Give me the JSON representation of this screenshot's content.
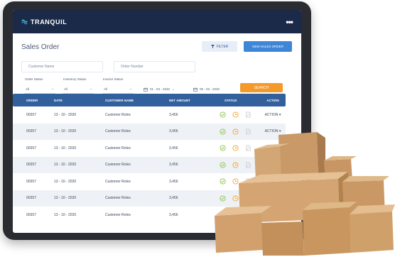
{
  "app": {
    "brand": "TRANQUIL",
    "menu": "•••"
  },
  "page": {
    "title": "Sales Order"
  },
  "toolbar": {
    "filter_label": "FILTER",
    "new_label": "NEW SALES ORDER"
  },
  "fields": {
    "customer_name_placeholder": "Customer Name",
    "order_number_placeholder": "Order Number"
  },
  "selects": [
    {
      "label": "Order Status",
      "value": "All"
    },
    {
      "label": "Inventory Status",
      "value": "All"
    },
    {
      "label": "Invoice Status",
      "value": "All"
    }
  ],
  "dates": {
    "from": "01 - 03 - 2020",
    "to": "05 - 03 - 2020"
  },
  "search_label": "SEARCH",
  "table": {
    "headers": [
      "ORDER",
      "DATE",
      "CUSTOMER NAME",
      "NET AMOUNT",
      "STATUS",
      "ACTION"
    ],
    "rows": [
      {
        "order": "00357",
        "date": "13 - 10 - 2020",
        "customer": "Customer Roles",
        "amount": "3,456",
        "action": "ACTION ▾"
      },
      {
        "order": "00357",
        "date": "13 - 10 - 2020",
        "customer": "Customer Roles",
        "amount": "3,456",
        "action": "ACTION ▾"
      },
      {
        "order": "00357",
        "date": "13 - 10 - 2020",
        "customer": "Customer Roles",
        "amount": "3,456",
        "action": "ACTION ▾"
      },
      {
        "order": "00357",
        "date": "13 - 10 - 2020",
        "customer": "Customer Roles",
        "amount": "3,456",
        "action": ""
      },
      {
        "order": "00357",
        "date": "13 - 10 - 2020",
        "customer": "Customer Roles",
        "amount": "3,456",
        "action": ""
      },
      {
        "order": "00357",
        "date": "13 - 10 - 2020",
        "customer": "Customer Roles",
        "amount": "3,456",
        "action": ""
      },
      {
        "order": "00357",
        "date": "13 - 10 - 2020",
        "customer": "Customer Roles",
        "amount": "3,456",
        "action": ""
      }
    ]
  },
  "colors": {
    "topbar": "#1b2a49",
    "table_header": "#31609d",
    "primary": "#3e86d8",
    "search": "#f39a2a",
    "status_green": "#8bc34a",
    "status_orange": "#f5a623",
    "status_grey": "#c8ccd2"
  },
  "icons": {
    "logo": "wave-logo-icon",
    "filter": "funnel-icon",
    "calendar": "calendar-icon",
    "status": [
      "check-circle-icon",
      "clock-icon",
      "document-icon"
    ]
  }
}
